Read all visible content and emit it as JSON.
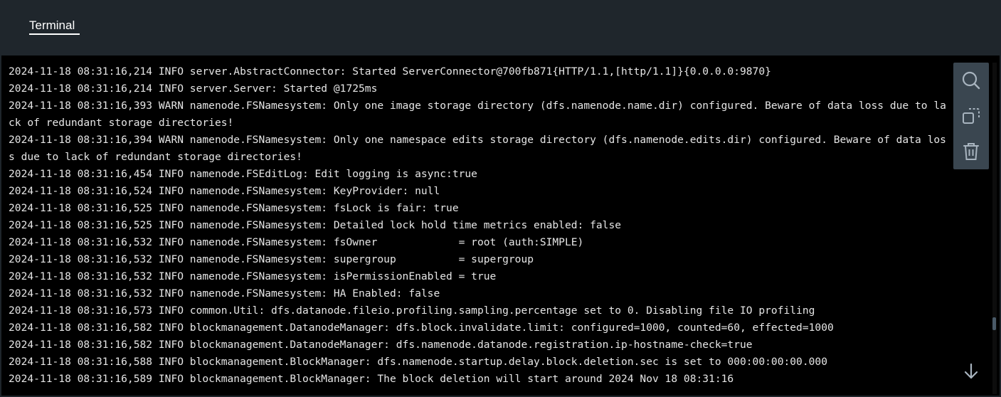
{
  "header": {
    "tab_label": "Terminal"
  },
  "terminal": {
    "lines": [
      "2024-11-18 08:31:16,214 INFO server.AbstractConnector: Started ServerConnector@700fb871{HTTP/1.1,[http/1.1]}{0.0.0.0:9870}",
      "2024-11-18 08:31:16,214 INFO server.Server: Started @1725ms",
      "2024-11-18 08:31:16,393 WARN namenode.FSNamesystem: Only one image storage directory (dfs.namenode.name.dir) configured. Beware of data loss due to lack of redundant storage directories!",
      "2024-11-18 08:31:16,394 WARN namenode.FSNamesystem: Only one namespace edits storage directory (dfs.namenode.edits.dir) configured. Beware of data loss due to lack of redundant storage directories!",
      "2024-11-18 08:31:16,454 INFO namenode.FSEditLog: Edit logging is async:true",
      "2024-11-18 08:31:16,524 INFO namenode.FSNamesystem: KeyProvider: null",
      "2024-11-18 08:31:16,525 INFO namenode.FSNamesystem: fsLock is fair: true",
      "2024-11-18 08:31:16,525 INFO namenode.FSNamesystem: Detailed lock hold time metrics enabled: false",
      "2024-11-18 08:31:16,532 INFO namenode.FSNamesystem: fsOwner             = root (auth:SIMPLE)",
      "2024-11-18 08:31:16,532 INFO namenode.FSNamesystem: supergroup          = supergroup",
      "2024-11-18 08:31:16,532 INFO namenode.FSNamesystem: isPermissionEnabled = true",
      "2024-11-18 08:31:16,532 INFO namenode.FSNamesystem: HA Enabled: false",
      "2024-11-18 08:31:16,573 INFO common.Util: dfs.datanode.fileio.profiling.sampling.percentage set to 0. Disabling file IO profiling",
      "2024-11-18 08:31:16,582 INFO blockmanagement.DatanodeManager: dfs.block.invalidate.limit: configured=1000, counted=60, effected=1000",
      "2024-11-18 08:31:16,582 INFO blockmanagement.DatanodeManager: dfs.namenode.datanode.registration.ip-hostname-check=true",
      "2024-11-18 08:31:16,588 INFO blockmanagement.BlockManager: dfs.namenode.startup.delay.block.deletion.sec is set to 000:00:00:00.000",
      "2024-11-18 08:31:16,589 INFO blockmanagement.BlockManager: The block deletion will start around 2024 Nov 18 08:31:16"
    ]
  },
  "toolbar": {
    "icons": [
      "search-icon",
      "copy-icon",
      "trash-icon"
    ]
  },
  "scroll": {
    "down_icon": "arrow-down-icon"
  },
  "colors": {
    "background": "#000000",
    "header": "#1f262c",
    "text": "#e6e6e6",
    "toolbar": "#3a4650",
    "icon": "#a8b4bf"
  }
}
